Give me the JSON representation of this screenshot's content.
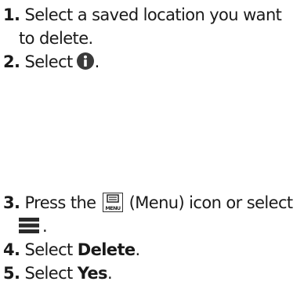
{
  "steps": [
    {
      "number": "1.",
      "line1": "Select a saved location you want",
      "line2": "to delete."
    },
    {
      "number": "2.",
      "text_before": "Select",
      "icon": "info-icon",
      "text_after": "."
    },
    {
      "number": "3.",
      "text_before": "Press the",
      "icon": "menu-icon",
      "text_after": "(Menu) icon or select",
      "icon2": "hamburger-menu-icon",
      "text_after2": "."
    },
    {
      "number": "4.",
      "text_before": "Select",
      "bold": "Delete",
      "text_after": "."
    },
    {
      "number": "5.",
      "text_before": "Select",
      "bold": "Yes",
      "text_after": "."
    }
  ],
  "icon_labels": {
    "menu_icon_text": "MENU"
  }
}
